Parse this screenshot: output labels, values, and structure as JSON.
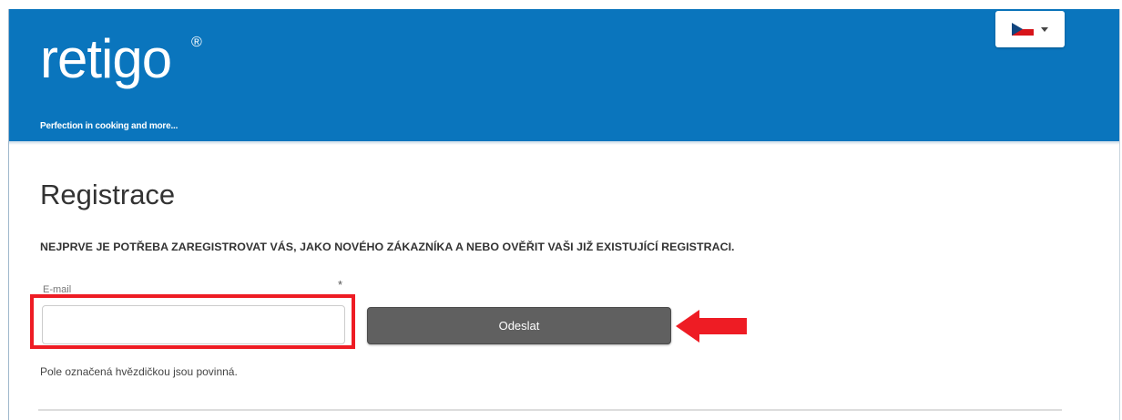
{
  "header": {
    "logo_text": "retigo",
    "logo_mark": "®",
    "tagline": "Perfection in cooking and more...",
    "language": {
      "flag_icon": "czech-flag-icon",
      "selected": "CZ"
    }
  },
  "main": {
    "title": "Registrace",
    "subtitle": "NEJPRVE JE POTŘEBA ZAREGISTROVAT VÁS, JAKO NOVÉHO ZÁKAZNÍKA A NEBO OVĚŘIT VAŠI JIŽ EXISTUJÍCÍ REGISTRACI.",
    "form": {
      "email_label": "E-mail",
      "required_mark": "*",
      "email_value": "",
      "submit_label": "Odeslat"
    },
    "required_note": "Pole označená hvězdičkou jsou povinná."
  },
  "annotations": {
    "highlight_color": "#ee1c24",
    "arrow_icon": "left-arrow-icon"
  },
  "colors": {
    "header_bg": "#0a75bd",
    "button_bg": "#606060"
  }
}
